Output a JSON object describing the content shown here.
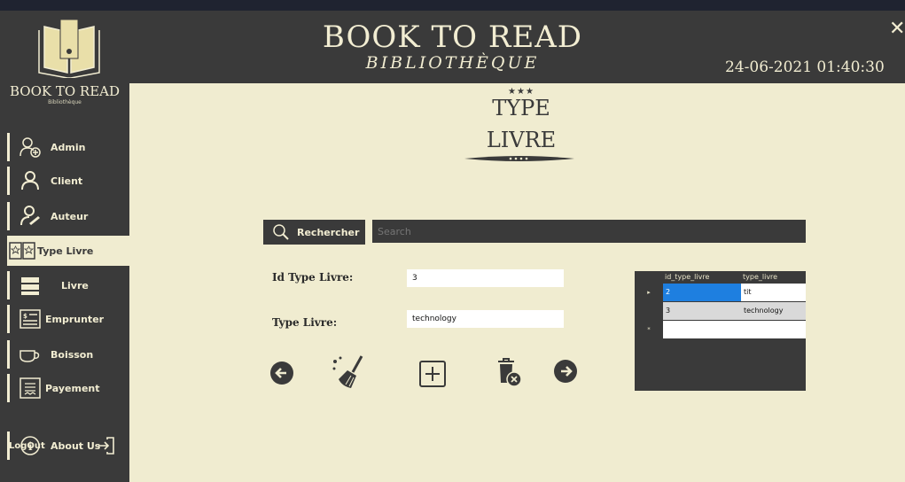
{
  "app": {
    "title": "BOOK TO READ",
    "subtitle": "BIBLIOTHÈQUE",
    "datetime": "24-06-2021 01:40:30",
    "close_glyph": "✕"
  },
  "sidebar": {
    "brand": "BOOK TO READ",
    "brand_sub": "Bibliothèque",
    "items": [
      {
        "label": "Admin",
        "icon": "admin-user-add-icon"
      },
      {
        "label": "Client",
        "icon": "client-user-icon"
      },
      {
        "label": "Auteur",
        "icon": "author-pen-icon"
      },
      {
        "label": "Type Livre",
        "icon": "book-type-icon"
      },
      {
        "label": "Livre",
        "icon": "book-icon"
      },
      {
        "label": "Emprunter",
        "icon": "borrow-ticket-icon"
      },
      {
        "label": "Boisson",
        "icon": "coffee-cup-icon"
      },
      {
        "label": "Payement",
        "icon": "receipt-icon"
      },
      {
        "label": "About Us",
        "icon": "info-icon"
      }
    ],
    "active": "Type Livre",
    "logout": "LogOut"
  },
  "page": {
    "stars": "★★★",
    "title_line1": "TYPE",
    "title_line2": "LIVRE"
  },
  "search": {
    "button_label": "Rechercher",
    "placeholder": "Search"
  },
  "form": {
    "id_label": "Id Type Livre:",
    "id_value": "3",
    "type_label": "Type Livre:",
    "type_value": "technology"
  },
  "grid": {
    "columns": [
      "id_type_livre",
      "type_livre"
    ],
    "rows": [
      {
        "indicator": "▸",
        "id": "2",
        "type": "tit",
        "selected": true
      },
      {
        "indicator": "",
        "id": "3",
        "type": "technology",
        "selected": false
      },
      {
        "indicator": "*",
        "id": "",
        "type": "",
        "selected": false
      }
    ]
  },
  "colors": {
    "dark": "#3a3a3a",
    "cream": "#f0ecd0",
    "selected": "#1e7fe0"
  }
}
